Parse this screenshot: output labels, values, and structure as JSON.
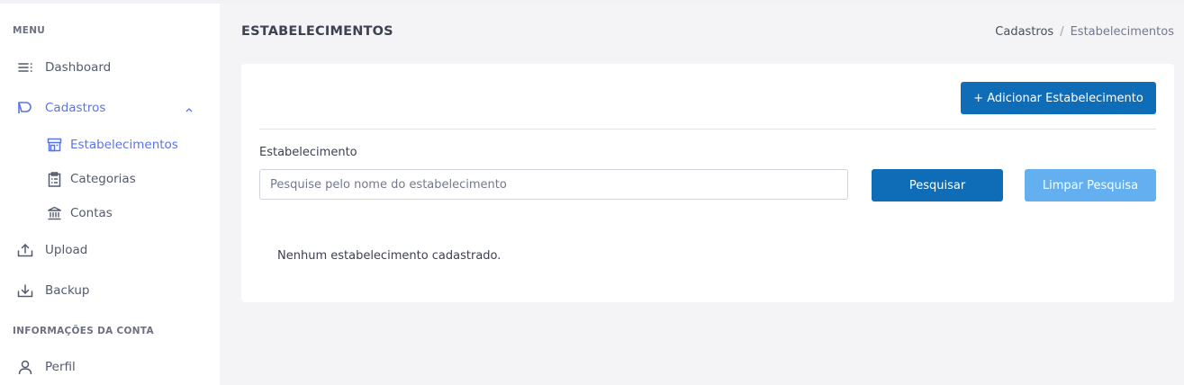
{
  "sidebar": {
    "menu_title": "MENU",
    "account_title": "INFORMAÇÕES DA CONTA",
    "items": {
      "dashboard": "Dashboard",
      "cadastros": "Cadastros",
      "estabelecimentos": "Estabelecimentos",
      "categorias": "Categorias",
      "contas": "Contas",
      "upload": "Upload",
      "backup": "Backup",
      "perfil": "Perfil"
    },
    "active_color": "#5b73e8"
  },
  "header": {
    "title": "ESTABELECIMENTOS",
    "breadcrumb": {
      "parent": "Cadastros",
      "separator": "/",
      "current": "Estabelecimentos"
    }
  },
  "main": {
    "add_button": "+ Adicionar Estabelecimento",
    "field_label": "Estabelecimento",
    "search_placeholder": "Pesquise pelo nome do estabelecimento",
    "search_value": "",
    "search_button": "Pesquisar",
    "clear_button": "Limpar Pesquisa",
    "empty_message": "Nenhum estabelecimento cadastrado."
  },
  "colors": {
    "primary": "#0f6db8",
    "primary_light": "#63aff0"
  },
  "icons": {
    "dashboard": "menu-lines-icon",
    "cadastros": "tag-icon",
    "estabelecimentos": "store-icon",
    "categorias": "clipboard-icon",
    "contas": "bank-icon",
    "upload": "upload-icon",
    "backup": "download-icon",
    "perfil": "user-icon"
  }
}
